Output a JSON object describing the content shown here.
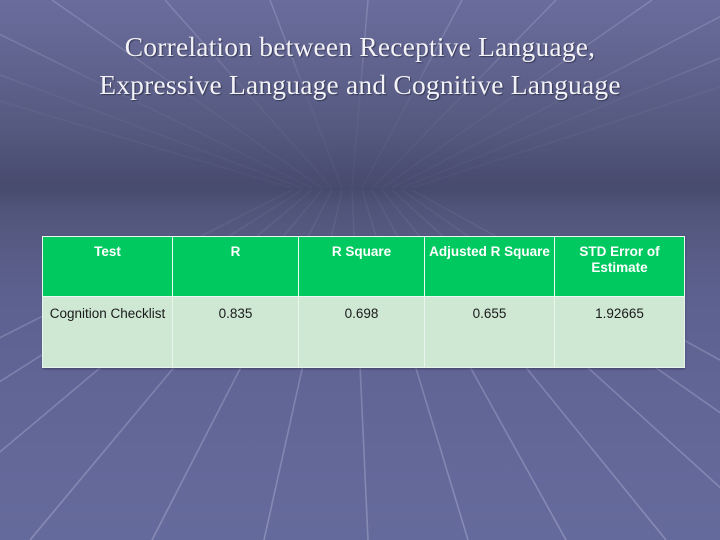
{
  "slide": {
    "title_lines": [
      "Correlation between Receptive Language,",
      "Expressive Language and Cognitive Language"
    ],
    "background_style": "perspective-grid",
    "colors": {
      "background_top": "#6a6d9c",
      "background_horizon": "#474b6e",
      "background_bottom": "#656a9c",
      "grid_line": "#8e91b8",
      "title_text": "#f2f2f7",
      "header_fill": "#00c95f",
      "header_text": "#ffffff",
      "cell_fill": "#cfe8d4",
      "cell_text": "#1a1a1a",
      "cell_border": "#e8f4ec"
    }
  },
  "table": {
    "headers": [
      "Test",
      "R",
      "R Square",
      "Adjusted R Square",
      "STD Error of Estimate"
    ],
    "rows": [
      {
        "test": "Cognition Checklist",
        "r": "0.835",
        "r_square": "0.698",
        "adjusted_r_square": "0.655",
        "std_error_of_estimate": "1.92665"
      }
    ]
  }
}
